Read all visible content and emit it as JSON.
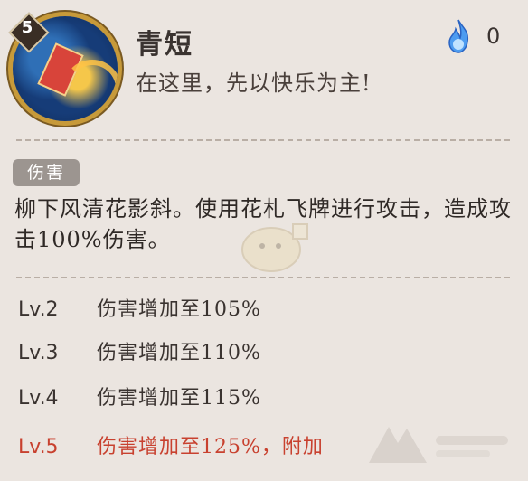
{
  "skill": {
    "level": "5",
    "name": "青短",
    "quote": "在这里，先以快乐为主!",
    "cost": "0",
    "icon": "flower-card-skill-icon",
    "cost_icon": "blue-soul-fire-icon"
  },
  "section": {
    "tag": "伤害",
    "description": "柳下风清花影斜。使用花札飞牌进行攻击，造成攻击100%伤害。"
  },
  "levels": [
    {
      "lv": "Lv.2",
      "effect": "伤害增加至105%"
    },
    {
      "lv": "Lv.3",
      "effect": "伤害增加至110%"
    },
    {
      "lv": "Lv.4",
      "effect": "伤害增加至115%"
    },
    {
      "lv": "Lv.5",
      "effect": "伤害增加至125%，附加"
    }
  ],
  "colors": {
    "background": "#ebe5e0",
    "text": "#2f2926",
    "highlight_level": "#c8412f",
    "tag_bg": "#9c9590"
  }
}
